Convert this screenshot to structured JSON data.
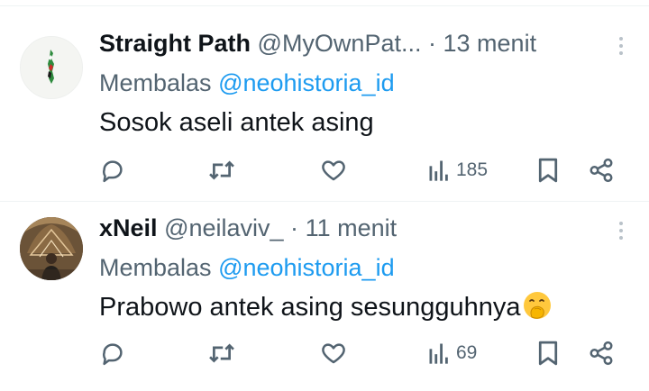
{
  "replying_label": "Membalas",
  "tweets": [
    {
      "display_name": "Straight Path",
      "handle": "@MyOwnPat...",
      "separator": "·",
      "time": "13 menit",
      "reply_to": "@neohistoria_id",
      "text": "Sosok aseli antek asing",
      "views": "185"
    },
    {
      "display_name": "xNeil",
      "handle": "@neilaviv_",
      "separator": "·",
      "time": "11 menit",
      "reply_to": "@neohistoria_id",
      "text": "Prabowo antek asing sesungguhnya",
      "views": "69",
      "emoji": "face-with-hand-over-mouth"
    }
  ],
  "icons": [
    "reply-icon",
    "retweet-icon",
    "like-icon",
    "views-icon",
    "bookmark-icon",
    "share-icon",
    "more-icon"
  ],
  "colors": {
    "text": "#0f1419",
    "muted": "#536471",
    "link": "#1d9bf0",
    "divider": "#eff3f4"
  }
}
